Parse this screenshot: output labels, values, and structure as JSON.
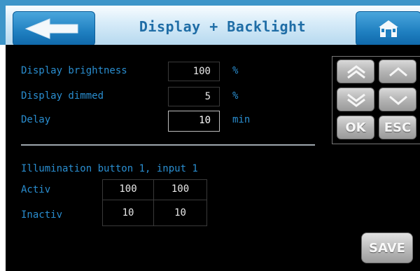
{
  "header": {
    "title": "Display + Backlight",
    "back_icon": "arrow-left-icon",
    "home_icon": "home-icon"
  },
  "display_settings": {
    "rows": [
      {
        "label": "Display brightness",
        "value": "100",
        "unit": "%"
      },
      {
        "label": "Display dimmed",
        "value": "5",
        "unit": "%"
      },
      {
        "label": "Delay",
        "value": "10",
        "unit": "min"
      }
    ]
  },
  "illumination": {
    "heading": "Illumination button 1, input 1",
    "rows": [
      {
        "label": "Activ",
        "values": [
          "100",
          "100"
        ]
      },
      {
        "label": "Inactiv",
        "values": [
          "10",
          "10"
        ]
      }
    ]
  },
  "keypad": {
    "ok_label": "OK",
    "esc_label": "ESC",
    "icons": [
      "double-up-icon",
      "up-icon",
      "double-down-icon",
      "down-icon"
    ]
  },
  "save_label": "SAVE",
  "colors": {
    "header_bg": "#3d95c9",
    "label_blue": "#2a8ed0",
    "screen_bg": "#000000"
  }
}
